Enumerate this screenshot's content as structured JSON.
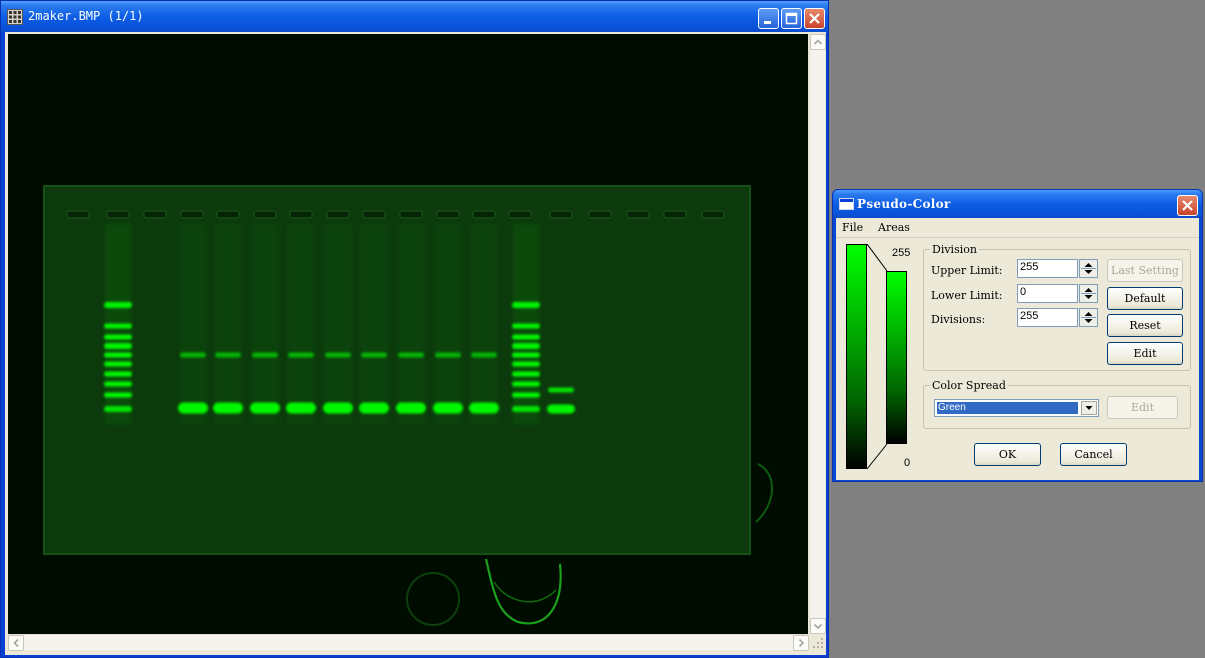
{
  "image_window": {
    "title": "2maker.BMP  (1/1)",
    "controls": {
      "minimize": "minimize-icon",
      "maximize": "maximize-icon",
      "close": "close-icon"
    },
    "image": {
      "subject": "fluorescent gel electrophoresis",
      "tint": "#00ff00"
    }
  },
  "dialog": {
    "title": "Pseudo-Color",
    "menu": {
      "file": "File",
      "areas": "Areas"
    },
    "scale": {
      "top": "255",
      "bottom": "0"
    },
    "division": {
      "legend": "Division",
      "upper_label": "Upper Limit:",
      "upper_value": "255",
      "lower_label": "Lower Limit:",
      "lower_value": "0",
      "divisions_label": "Divisions:",
      "divisions_value": "255"
    },
    "buttons": {
      "last_setting": "Last Setting",
      "default": "Default",
      "reset": "Reset",
      "edit": "Edit"
    },
    "color_spread": {
      "legend": "Color Spread",
      "selected": "Green",
      "edit": "Edit"
    },
    "ok": "OK",
    "cancel": "Cancel",
    "colors": {
      "title_bar": "#0d5ee6",
      "face": "#ece9d8",
      "selection": "#316ac5"
    }
  }
}
